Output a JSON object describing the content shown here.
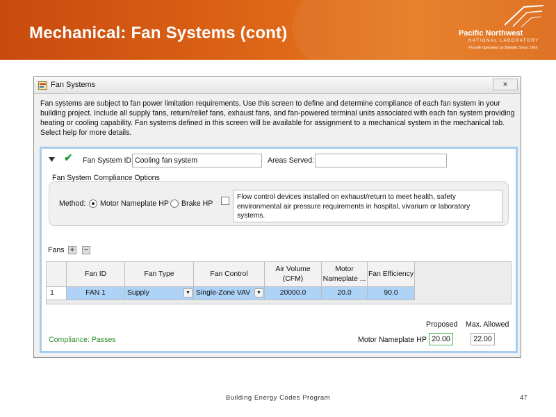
{
  "slide": {
    "title": "Mechanical: Fan Systems (cont)",
    "footer": "Building Energy Codes Program",
    "page_number": "47",
    "banner_color": "#d95a14"
  },
  "logo": {
    "name": "Pacific Northwest",
    "sub": "NATIONAL LABORATORY",
    "tagline": "Proudly Operated by Battelle Since 1965"
  },
  "window": {
    "title": "Fan Systems",
    "icon": "app-icon",
    "close_label": "×",
    "description": "Fan systems are subject to fan power limitation requirements. Use this screen to define and determine compliance of each fan system in your building project. Include all supply fans, return/relief fans, exhaust fans, and fan-powered terminal units associated with each fan system providing heating or cooling capability. Fan systems defined in this screen will be available for assignment to a mechanical system in the mechanical tab. Select help for more details."
  },
  "fan_system": {
    "id_label": "Fan System ID:",
    "id_value": "Cooling fan system",
    "areas_label": "Areas Served:",
    "areas_value": "",
    "status_icon": "check-icon",
    "status_color": "#1e9e2e"
  },
  "compliance_options": {
    "legend": "Fan System Compliance Options",
    "method_label": "Method:",
    "methods": [
      {
        "label": "Motor Nameplate HP",
        "selected": true
      },
      {
        "label": "Brake HP",
        "selected": false
      }
    ],
    "flow_control_checked": false,
    "flow_control_text": "Flow control devices installed on exhaust/return to meet health, safety environmental air pressure requirements in hospital, vivarium or laboratory systems."
  },
  "fans": {
    "label": "Fans",
    "add_icon": "plus-icon",
    "remove_icon": "minus-icon",
    "columns": [
      "",
      "Fan ID",
      "Fan Type",
      "Fan Control",
      "Air Volume (CFM)",
      "Motor Nameplate ...",
      "Fan Efficiency"
    ],
    "rows": [
      [
        "1",
        "FAN 1",
        "Supply",
        "Single-Zone VAV",
        "20000.0",
        "20.0",
        "90.0"
      ]
    ]
  },
  "compliance": {
    "status": "Compliance: Passes",
    "status_color": "#2a8a2a",
    "proposed_label": "Proposed",
    "allowed_label": "Max. Allowed",
    "metric_label": "Motor Nameplate HP",
    "proposed_value": "20.00",
    "allowed_value": "22.00"
  }
}
